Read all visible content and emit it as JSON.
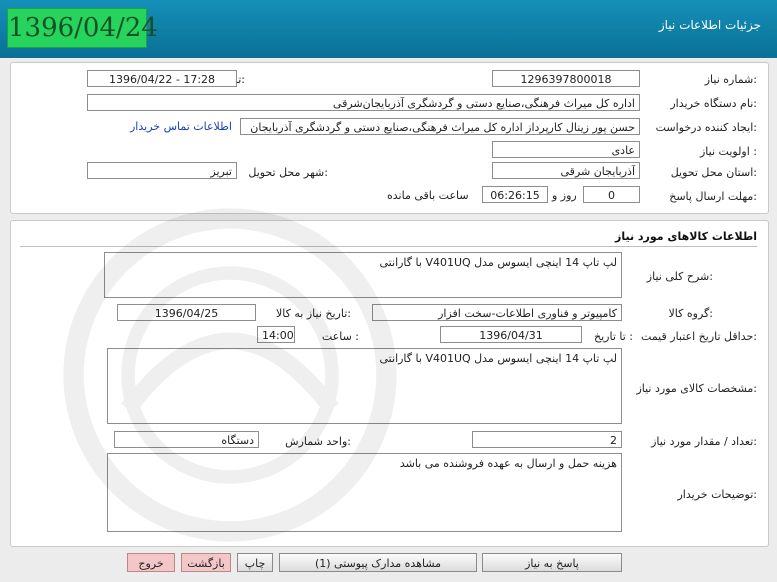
{
  "header": {
    "date": "1396/04/24",
    "title": "جزئیات اطلاعات نیاز"
  },
  "need_info": {
    "need_number_label": "شماره نیاز:",
    "need_number": "1296397800018",
    "announce_label": "تاریخ و ساعت اعلان عمومی:",
    "announce_value": "1396/04/22 - 17:28",
    "buyer_org_label": "نام دستگاه خریدار:",
    "buyer_org": "اداره کل میراث فرهنگی،صنایع دستی و گردشگری آذربایجان‌شرقی",
    "requester_label": "ایجاد کننده درخواست:",
    "requester": "حسن پور زینال کارپرداز اداره کل میراث فرهنگی،صنایع دستی و گردشگری آذربایجان",
    "buyer_contact_link": "اطلاعات تماس خریدار",
    "priority_label": "اولویت نیاز :",
    "priority": "عادی",
    "province_label": "استان محل تحویل:",
    "province": "آذربایجان شرقی",
    "city_label": "شهر محل تحویل:",
    "city": "تبریز",
    "deadline_label": "مهلت ارسال پاسخ:",
    "days": "0",
    "days_unit": "روز و",
    "time_left": "06:26:15",
    "time_left_suffix": "ساعت باقی مانده"
  },
  "goods": {
    "section_title": "اطلاعات کالاهای مورد نیاز",
    "desc_label": "شرح کلی نیاز:",
    "desc": "لپ تاپ 14 اینچی ایسوس مدل V401UQ با گارانتی",
    "group_label": "گروه کالا:",
    "group": "کامپیوتر و فناوری اطلاعات-سخت افزار",
    "need_date_label": "تاریخ نیاز به کالا:",
    "need_date": "1396/04/25",
    "min_validity_label": "حداقل تاریخ اعتبار قیمت:",
    "until_date_label": "تا تاریخ :",
    "until_date": "1396/04/31",
    "hour_label": "ساعت :",
    "hour": "14:00",
    "specs_label": "مشخصات کالای مورد نیاز:",
    "specs": "لپ تاپ 14 اینچی ایسوس مدل V401UQ با گارانتی",
    "qty_label": "تعداد / مقدار مورد نیاز:",
    "qty": "2",
    "unit_label": "واحد شمارش:",
    "unit": "دستگاه",
    "buyer_notes_label": "توضیحات خریدار:",
    "buyer_notes": "هزینه حمل و ارسال به عهده فروشنده می باشد"
  },
  "buttons": {
    "reply": "پاسخ به نیاز",
    "attachments": "مشاهده مدارک پیوستی (1)",
    "print": "چاپ",
    "back": "بازگشت",
    "exit": "خروج"
  }
}
